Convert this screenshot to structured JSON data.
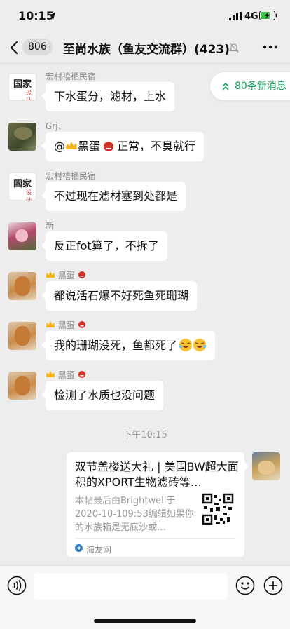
{
  "status": {
    "time": "10:15",
    "network": "4G"
  },
  "nav": {
    "back_count": "806",
    "title": "至尚水族（鱼友交流群）(423)"
  },
  "new_messages": {
    "label": "80条新消息"
  },
  "messages": [
    {
      "sender": "宏村禧栖民宿",
      "text": "下水蛋分，滤材，上水"
    },
    {
      "sender": "Grj、",
      "mention_prefix": "@",
      "mention_name": "黑蛋",
      "text": "正常，不臭就行"
    },
    {
      "sender": "宏村禧栖民宿",
      "text": "不过现在滤材塞到处都是"
    },
    {
      "sender": "新",
      "text": "反正fot算了，不拆了"
    },
    {
      "sender": "黑蛋",
      "text": "都说活石爆不好死鱼死珊瑚"
    },
    {
      "sender": "黑蛋",
      "text": "我的珊瑚没死，鱼都死了"
    },
    {
      "sender": "黑蛋",
      "text": "检测了水质也没问题"
    }
  ],
  "timestamp": "下午10:15",
  "shared_card": {
    "title": "双节盖楼送大礼 | 美国BW超大面积的XPORT生物滤砖等…",
    "desc": "本帖最后由Brightwell于2020-10-109:53编辑如果你的水族箱是无底沙或…",
    "source": "海友网"
  },
  "avatar_text": {
    "guojia_top": "国家",
    "guojia_sub": "设计"
  },
  "colors": {
    "accent_green": "#19a15f",
    "background": "#ededed"
  }
}
